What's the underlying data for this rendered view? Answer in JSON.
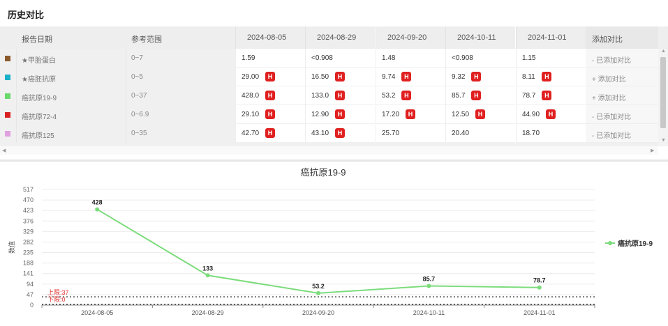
{
  "page": {
    "title": "历史对比"
  },
  "table": {
    "headers": {
      "report_date": "报告日期",
      "ref_range": "参考范围",
      "dates": [
        "2024-08-05",
        "2024-08-29",
        "2024-09-20",
        "2024-10-11",
        "2024-11-01"
      ],
      "action": "添加对比"
    },
    "rows": [
      {
        "color": "#8b5a2b",
        "name": "★甲胎蛋白",
        "range": "0~7",
        "values": [
          {
            "v": "1.59",
            "h": false
          },
          {
            "v": "<0.908",
            "h": false
          },
          {
            "v": "1.48",
            "h": false
          },
          {
            "v": "<0.908",
            "h": false
          },
          {
            "v": "1.15",
            "h": false
          }
        ],
        "action": "- 已添加对比"
      },
      {
        "color": "#1ab0c8",
        "name": "★癌胚抗原",
        "range": "0~5",
        "values": [
          {
            "v": "29.00",
            "h": true
          },
          {
            "v": "16.50",
            "h": true
          },
          {
            "v": "9.74",
            "h": true
          },
          {
            "v": "9.32",
            "h": true
          },
          {
            "v": "8.11",
            "h": true
          }
        ],
        "action": "+ 添加对比"
      },
      {
        "color": "#6ad86a",
        "name": "癌抗原19-9",
        "range": "0~37",
        "values": [
          {
            "v": "428.0",
            "h": true
          },
          {
            "v": "133.0",
            "h": true
          },
          {
            "v": "53.2",
            "h": true
          },
          {
            "v": "85.7",
            "h": true
          },
          {
            "v": "78.7",
            "h": true
          }
        ],
        "action": "+ 添加对比"
      },
      {
        "color": "#d82020",
        "name": "癌抗原72-4",
        "range": "0~6.9",
        "values": [
          {
            "v": "29.10",
            "h": true
          },
          {
            "v": "12.90",
            "h": true
          },
          {
            "v": "17.20",
            "h": true
          },
          {
            "v": "12.50",
            "h": true
          },
          {
            "v": "44.90",
            "h": true
          }
        ],
        "action": "- 已添加对比"
      },
      {
        "color": "#e0a0e0",
        "name": "癌抗原125",
        "range": "0~35",
        "values": [
          {
            "v": "42.70",
            "h": true
          },
          {
            "v": "43.10",
            "h": true
          },
          {
            "v": "25.70",
            "h": false
          },
          {
            "v": "20.40",
            "h": false
          },
          {
            "v": "18.70",
            "h": false
          }
        ],
        "action": "- 已添加对比"
      }
    ],
    "high_badge": "H"
  },
  "chart_data": {
    "type": "line",
    "title": "癌抗原19-9",
    "ylabel": "数值",
    "xlabel": "",
    "categories": [
      "2024-08-05",
      "2024-08-29",
      "2024-09-20",
      "2024-10-11",
      "2024-11-01"
    ],
    "series": [
      {
        "name": "癌抗原19-9",
        "values": [
          428,
          133,
          53.2,
          85.7,
          78.7
        ],
        "labels": [
          "428",
          "133",
          "53.2",
          "85.7",
          "78.7"
        ],
        "color": "#7cdc7c"
      }
    ],
    "yticks": [
      0,
      47,
      94,
      141,
      188,
      235,
      282,
      329,
      376,
      423,
      470,
      517
    ],
    "ylim": [
      0,
      517
    ],
    "upper_limit": {
      "label": "上限:37",
      "value": 37
    },
    "lower_limit": {
      "label": "下限:0",
      "value": 0
    },
    "legend": "right",
    "grid": true
  }
}
